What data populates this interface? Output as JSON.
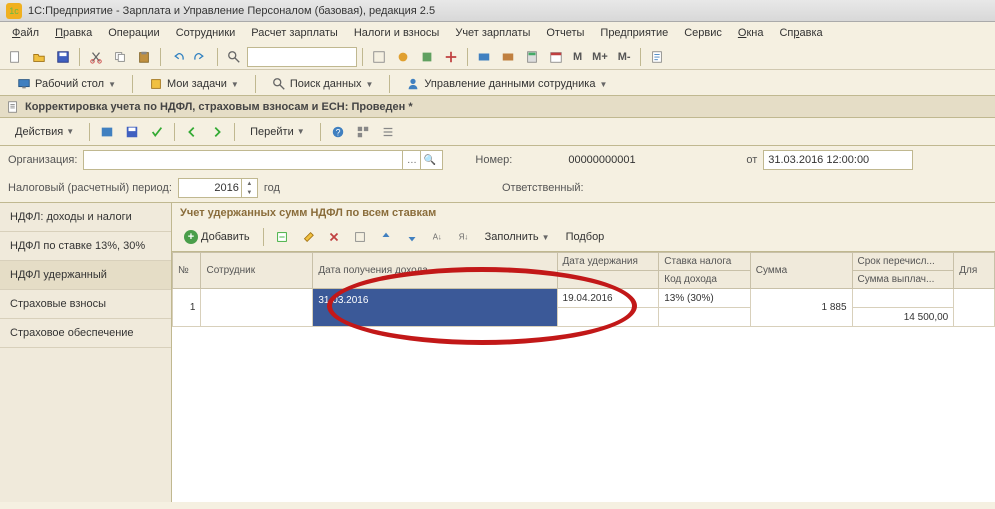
{
  "title": "1С:Предприятие - Зарплата и Управление Персоналом (базовая), редакция 2.5",
  "menu": [
    "Файл",
    "Правка",
    "Операции",
    "Сотрудники",
    "Расчет зарплаты",
    "Налоги и взносы",
    "Учет зарплаты",
    "Отчеты",
    "Предприятие",
    "Сервис",
    "Окна",
    "Справка"
  ],
  "toolbar2_labels": {
    "m": "M",
    "mplus": "M+",
    "mminus": "M-"
  },
  "tabs": {
    "desktop": "Рабочий стол",
    "tasks": "Мои задачи",
    "search": "Поиск данных",
    "empdata": "Управление данными сотрудника"
  },
  "doc_title": "Корректировка учета по НДФЛ, страховым взносам и ЕСН: Проведен *",
  "actionbar": {
    "actions": "Действия",
    "goto": "Перейти"
  },
  "form": {
    "org_label": "Организация:",
    "period_label": "Налоговый (расчетный) период:",
    "period_value": "2016",
    "period_unit": "год",
    "number_label": "Номер:",
    "number_value": "00000000001",
    "from_label": "от",
    "date_value": "31.03.2016 12:00:00",
    "resp_label": "Ответственный:"
  },
  "sidebar": [
    "НДФЛ: доходы и налоги",
    "НДФЛ по ставке 13%, 30%",
    "НДФЛ удержанный",
    "Страховые взносы",
    "Страховое обеспечение"
  ],
  "section": {
    "title": "Учет удержанных сумм НДФЛ по всем ставкам",
    "add": "Добавить",
    "fill": "Заполнить",
    "pick": "Подбор"
  },
  "grid": {
    "headers": {
      "num": "№",
      "emp": "Сотрудник",
      "income_date": "Дата получения дохода",
      "withhold_date": "Дата удержания",
      "rate": "Ставка налога",
      "income_code": "Код дохода",
      "sum": "Сумма",
      "transfer": "Срок перечисл...",
      "paid": "Сумма выплач...",
      "for": "Для"
    },
    "row": {
      "n": "1",
      "income_date": "31.03.2016",
      "withhold_date": "19.04.2016",
      "rate": "13% (30%)",
      "sum": "1 885",
      "paid": "14 500,00"
    }
  }
}
